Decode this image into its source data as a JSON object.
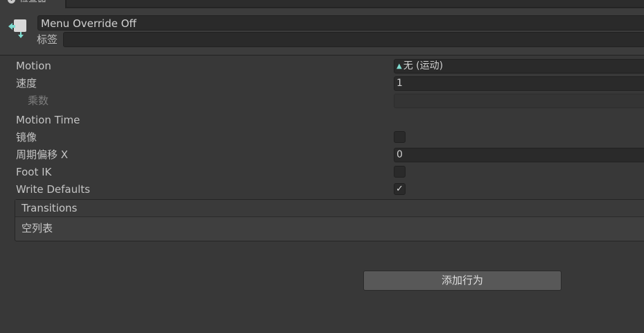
{
  "tab": {
    "title": "检查器",
    "icon": "info-icon"
  },
  "header": {
    "state_name": "Menu Override Off",
    "tag_label": "标签",
    "tag_value": "",
    "icon": "animator-state-icon"
  },
  "properties": {
    "motion": {
      "label": "Motion",
      "value": "无 (运动)",
      "icon": "motion-icon"
    },
    "speed": {
      "label": "速度",
      "value": "1"
    },
    "multiplier": {
      "label": "乘数",
      "value": ""
    },
    "motion_time": {
      "label": "Motion Time"
    },
    "mirror": {
      "label": "镜像",
      "checked": false
    },
    "cycle_offset": {
      "label": "周期偏移 X",
      "value": "0"
    },
    "foot_ik": {
      "label": "Foot IK",
      "checked": false
    },
    "write_defaults": {
      "label": "Write Defaults",
      "checked": true,
      "check_glyph": "✓"
    }
  },
  "transitions": {
    "title": "Transitions",
    "empty_text": "空列表"
  },
  "add_behaviour": {
    "label": "添加行为"
  },
  "colors": {
    "background": "#383838",
    "field": "#2a2a2a",
    "accent_icon": "#7fdcd0"
  }
}
